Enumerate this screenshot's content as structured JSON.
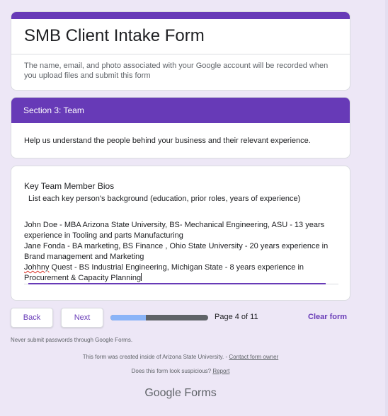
{
  "header": {
    "title": "SMB Client Intake Form",
    "notice": "The name, email, and photo associated with your Google account will be recorded when you upload files and submit this form"
  },
  "section": {
    "title": "Section 3: Team",
    "description": "Help us understand the people behind your business and their relevant experience."
  },
  "question": {
    "title": "Key Team Member Bios",
    "help": "List each key person's background (education, prior roles, years of experience)",
    "answer_line1": "John Doe - MBA Arizona State University, BS- Mechanical Engineering, ASU - 13 years experience in Tooling and parts Manufacturing",
    "answer_line2": "Jane Fonda - BA marketing, BS Finance , Ohio State University - 20 years experience in Brand management and Marketing",
    "answer_line3_word": "Johhny",
    "answer_line3_rest": " Quest - BS Industrial Engineering, Michigan State - 8 years experience in Procurement & Capacity Planning"
  },
  "nav": {
    "back_label": "Back",
    "next_label": "Next",
    "progress_fraction": 0.36,
    "page_text": "Page 4 of 11",
    "clear_label": "Clear form"
  },
  "footer": {
    "never_submit": "Never submit passwords through Google Forms.",
    "created_text": "This form was created inside of Arizona State University. - ",
    "contact_link": "Contact form owner",
    "suspicious_text": "Does this form look suspicious? ",
    "report_link": "Report",
    "logo_google": "Google",
    "logo_forms": "Forms"
  },
  "colors": {
    "accent": "#673ab7",
    "background": "#ede7f6",
    "progress_fill": "#8ab4f8"
  }
}
